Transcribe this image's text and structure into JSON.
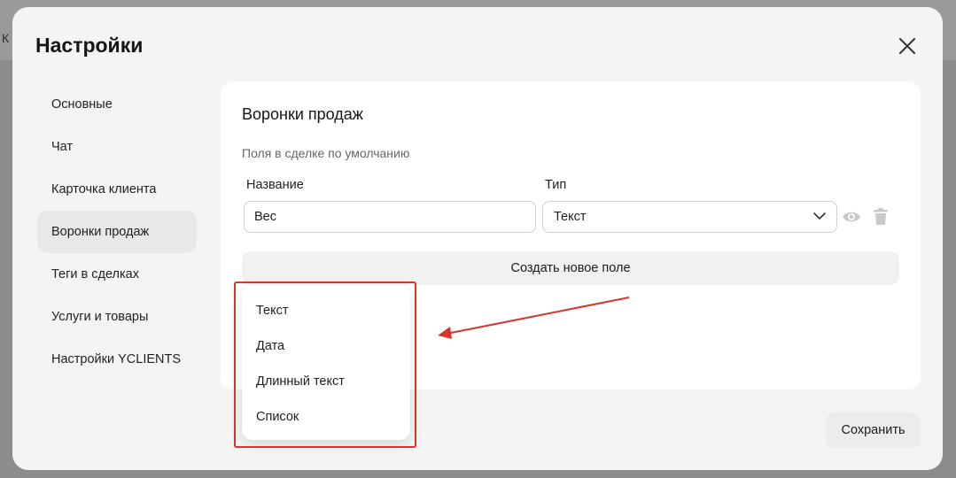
{
  "background": {
    "partial_text": "К"
  },
  "modal": {
    "title": "Настройки",
    "sidebar": {
      "items": [
        {
          "label": "Основные"
        },
        {
          "label": "Чат"
        },
        {
          "label": "Карточка клиента"
        },
        {
          "label": "Воронки продаж",
          "active": true
        },
        {
          "label": "Теги в сделках"
        },
        {
          "label": "Услуги и товары"
        },
        {
          "label": "Настройки YCLIENTS"
        }
      ]
    },
    "section": {
      "title": "Воронки продаж",
      "subtitle": "Поля в сделке по умолчанию",
      "name_label": "Название",
      "type_label": "Тип",
      "field": {
        "name_value": "Вес",
        "type_value": "Текст"
      },
      "create_button": "Создать новое поле"
    },
    "type_options": [
      "Текст",
      "Дата",
      "Длинный текст",
      "Список"
    ],
    "save_button": "Сохранить"
  },
  "colors": {
    "annotation": "#d9342b",
    "active_item_bg": "#e8e8e8"
  },
  "icons": [
    "close-icon",
    "chevron-down-icon",
    "eye-icon",
    "trash-icon",
    "arrow-annotation"
  ]
}
